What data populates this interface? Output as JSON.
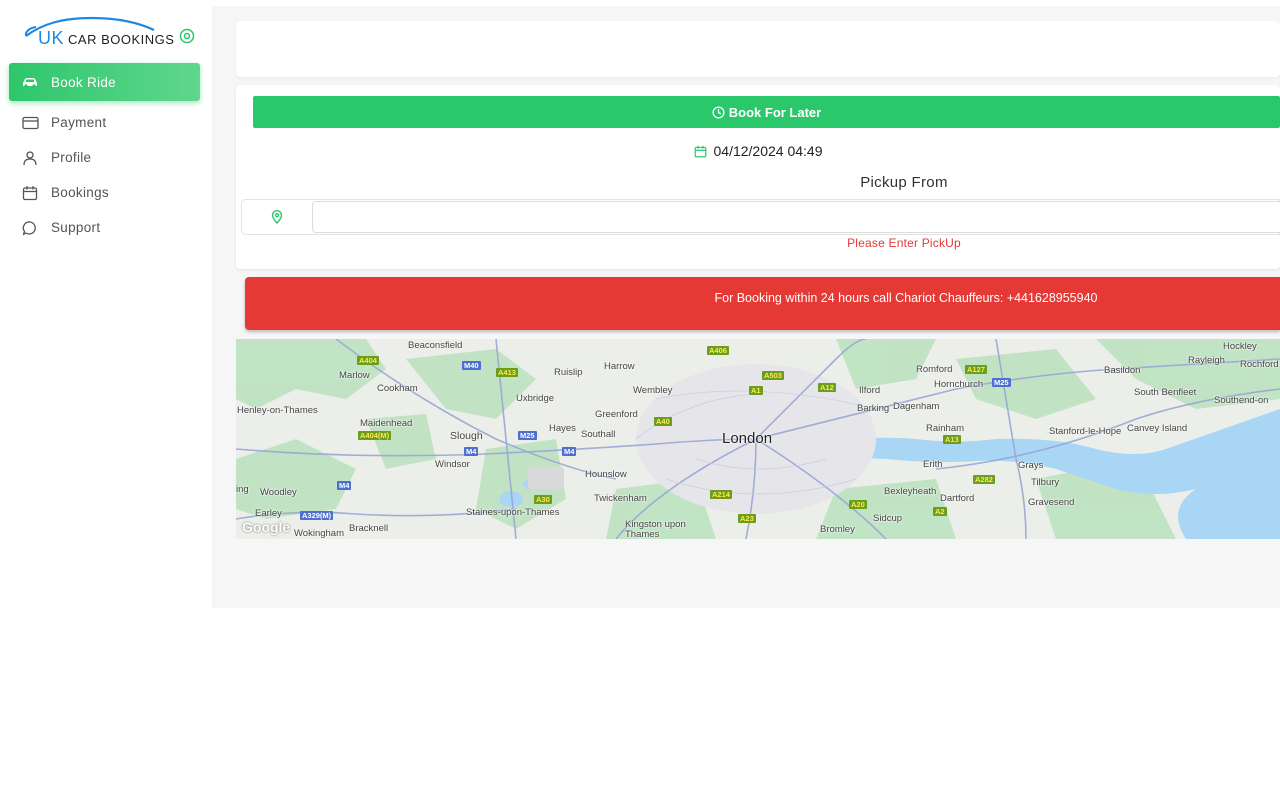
{
  "brand": {
    "logo_uk": "UK",
    "logo_rest": "CAR BOOKINGS"
  },
  "sidebar": {
    "items": [
      {
        "label": "Book Ride",
        "icon": "car-icon"
      },
      {
        "label": "Payment",
        "icon": "credit-card-icon"
      },
      {
        "label": "Profile",
        "icon": "user-icon"
      },
      {
        "label": "Bookings",
        "icon": "calendar-icon"
      },
      {
        "label": "Support",
        "icon": "chat-icon"
      }
    ]
  },
  "booking": {
    "later_button": "Book For Later",
    "datetime": "04/12/2024 04:49",
    "pickup_title": "Pickup From",
    "pickup_value": "",
    "pickup_placeholder": "",
    "pickup_error": "Please Enter PickUp"
  },
  "alert": {
    "text": "For Booking within 24 hours call Chariot Chauffeurs: +441628955940"
  },
  "colors": {
    "accent": "#2bc76b",
    "alert": "#e53935",
    "error": "#e53935"
  },
  "map": {
    "attribution": "Google",
    "places": [
      {
        "name": "Beaconsfield"
      },
      {
        "name": "Marlow"
      },
      {
        "name": "Cookham"
      },
      {
        "name": "Henley-on-Thames"
      },
      {
        "name": "Maidenhead"
      },
      {
        "name": "Slough"
      },
      {
        "name": "Windsor"
      },
      {
        "name": "Woodley"
      },
      {
        "name": "Earley"
      },
      {
        "name": "Wokingham"
      },
      {
        "name": "Bracknell"
      },
      {
        "name": "Uxbridge"
      },
      {
        "name": "Ruislip"
      },
      {
        "name": "Harrow"
      },
      {
        "name": "Wembley"
      },
      {
        "name": "Hayes"
      },
      {
        "name": "Southall"
      },
      {
        "name": "Greenford"
      },
      {
        "name": "Hounslow"
      },
      {
        "name": "Twickenham"
      },
      {
        "name": "Staines-upon-Thames"
      },
      {
        "name": "Kingston upon Thames"
      },
      {
        "name": "London"
      },
      {
        "name": "Ilford"
      },
      {
        "name": "Barking"
      },
      {
        "name": "Dagenham"
      },
      {
        "name": "Romford"
      },
      {
        "name": "Hornchurch"
      },
      {
        "name": "Rainham"
      },
      {
        "name": "Erith"
      },
      {
        "name": "Bexleyheath"
      },
      {
        "name": "Dartford"
      },
      {
        "name": "Sidcup"
      },
      {
        "name": "Bromley"
      },
      {
        "name": "Grays"
      },
      {
        "name": "Tilbury"
      },
      {
        "name": "Gravesend"
      },
      {
        "name": "Stanford-le-Hope"
      },
      {
        "name": "Canvey Island"
      },
      {
        "name": "Basildon"
      },
      {
        "name": "Rayleigh"
      },
      {
        "name": "Hockley"
      },
      {
        "name": "Rochford"
      },
      {
        "name": "South Benfleet"
      },
      {
        "name": "Southend-on"
      },
      {
        "name": "ing"
      }
    ],
    "roads": [
      "A404",
      "M40",
      "A413",
      "A406",
      "A503",
      "A1",
      "A12",
      "A127",
      "M25",
      "A13",
      "A404(M)",
      "M4",
      "A40",
      "A30",
      "A214",
      "A23",
      "A20",
      "A2",
      "A282",
      "A329(M)"
    ]
  }
}
